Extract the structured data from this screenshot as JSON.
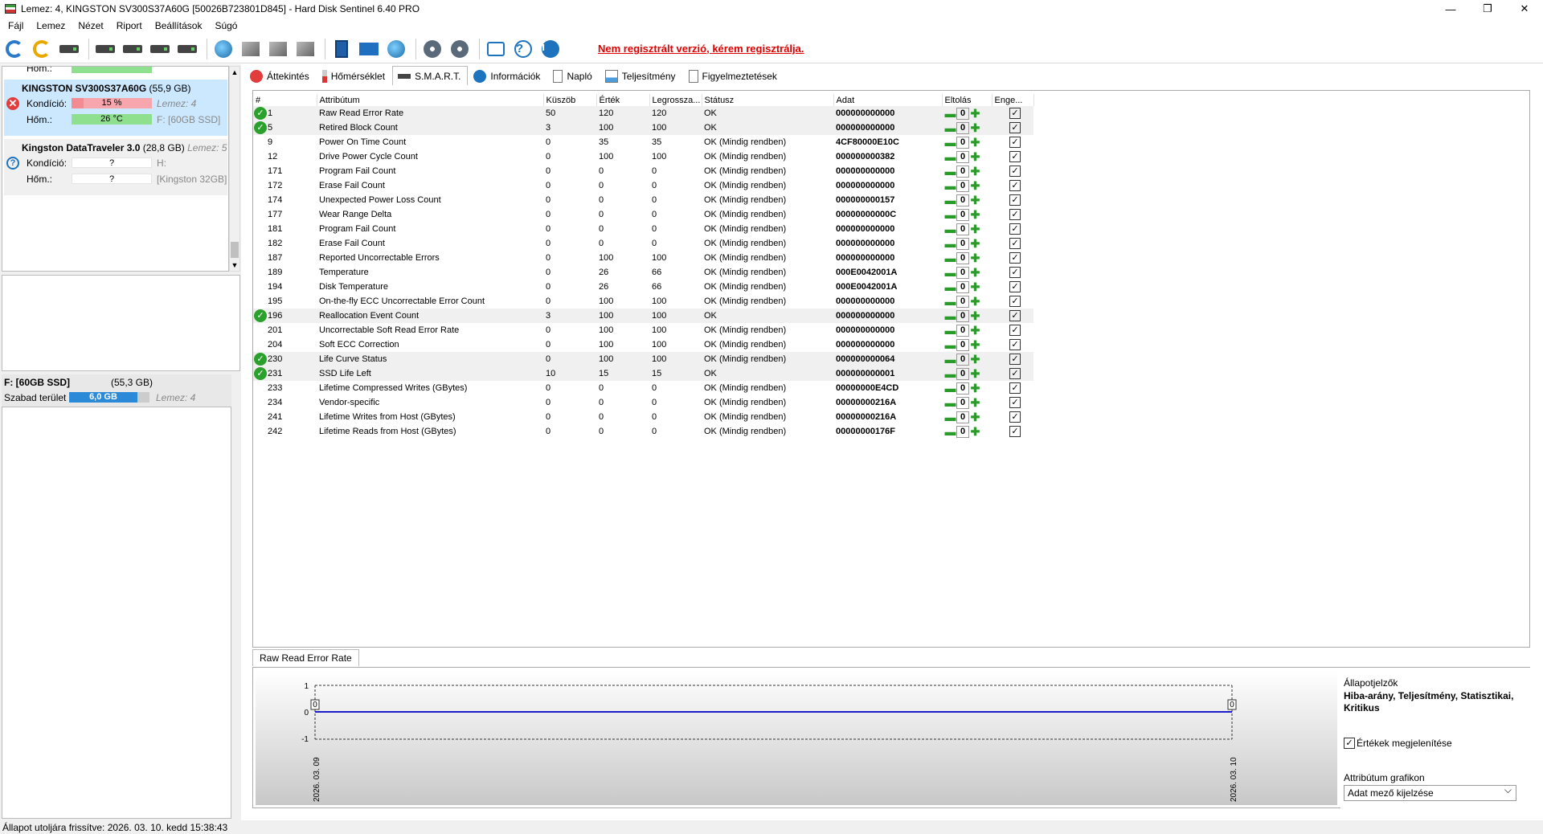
{
  "window": {
    "title": "Lemez: 4, KINGSTON SV300S37A60G [50026B723801D845]  -  Hard Disk Sentinel 6.40 PRO"
  },
  "menu": [
    "Fájl",
    "Lemez",
    "Nézet",
    "Riport",
    "Beállítások",
    "Súgó"
  ],
  "toolbar": {
    "register_text": "Nem regisztrált verzió, kérem regisztrálja."
  },
  "left": {
    "partial_row": "Hőm.:",
    "disk1": {
      "name": "KINGSTON SV300S37A60G",
      "size": "(55,9 GB)",
      "health_label": "Kondíció:",
      "health": "15 %",
      "health_extra": "Lemez: 4",
      "temp_label": "Hőm.:",
      "temp": "26 °C",
      "temp_extra": "F: [60GB SSD]"
    },
    "disk2": {
      "name": "Kingston DataTraveler 3.0",
      "size": "(28,8 GB)",
      "disk_no": "Lemez: 5",
      "health_label": "Kondíció:",
      "health": "?",
      "health_extra": "H:",
      "temp_label": "Hőm.:",
      "temp": "?",
      "temp_extra": "[Kingston 32GB]"
    },
    "volume": {
      "title": "F: [60GB SSD]",
      "size": "(55,3 GB)",
      "free_label": "Szabad terület",
      "free": "6,0 GB",
      "disk_no": "Lemez: 4"
    }
  },
  "tabs": [
    "Áttekintés",
    "Hőmérséklet",
    "S.M.A.R.T.",
    "Információk",
    "Napló",
    "Teljesítmény",
    "Figyelmeztetések"
  ],
  "smart": {
    "columns": [
      "#",
      "Attribútum",
      "Küszöb",
      "Érték",
      "Legrossza...",
      "Státusz",
      "Adat",
      "Eltolás",
      "Enge..."
    ],
    "rows": [
      {
        "id": "1",
        "name": "Raw Read Error Rate",
        "thr": "50",
        "val": "120",
        "worst": "120",
        "status": "OK",
        "data": "000000000000",
        "flag": true
      },
      {
        "id": "5",
        "name": "Retired Block Count",
        "thr": "3",
        "val": "100",
        "worst": "100",
        "status": "OK",
        "data": "000000000000",
        "flag": true
      },
      {
        "id": "9",
        "name": "Power On Time Count",
        "thr": "0",
        "val": "35",
        "worst": "35",
        "status": "OK (Mindig rendben)",
        "data": "4CF80000E10C",
        "flag": false
      },
      {
        "id": "12",
        "name": "Drive Power Cycle Count",
        "thr": "0",
        "val": "100",
        "worst": "100",
        "status": "OK (Mindig rendben)",
        "data": "000000000382",
        "flag": false
      },
      {
        "id": "171",
        "name": "Program Fail Count",
        "thr": "0",
        "val": "0",
        "worst": "0",
        "status": "OK (Mindig rendben)",
        "data": "000000000000",
        "flag": false
      },
      {
        "id": "172",
        "name": "Erase Fail Count",
        "thr": "0",
        "val": "0",
        "worst": "0",
        "status": "OK (Mindig rendben)",
        "data": "000000000000",
        "flag": false
      },
      {
        "id": "174",
        "name": "Unexpected Power Loss Count",
        "thr": "0",
        "val": "0",
        "worst": "0",
        "status": "OK (Mindig rendben)",
        "data": "000000000157",
        "flag": false
      },
      {
        "id": "177",
        "name": "Wear Range Delta",
        "thr": "0",
        "val": "0",
        "worst": "0",
        "status": "OK (Mindig rendben)",
        "data": "00000000000C",
        "flag": false
      },
      {
        "id": "181",
        "name": "Program Fail Count",
        "thr": "0",
        "val": "0",
        "worst": "0",
        "status": "OK (Mindig rendben)",
        "data": "000000000000",
        "flag": false
      },
      {
        "id": "182",
        "name": "Erase Fail Count",
        "thr": "0",
        "val": "0",
        "worst": "0",
        "status": "OK (Mindig rendben)",
        "data": "000000000000",
        "flag": false
      },
      {
        "id": "187",
        "name": "Reported Uncorrectable Errors",
        "thr": "0",
        "val": "100",
        "worst": "100",
        "status": "OK (Mindig rendben)",
        "data": "000000000000",
        "flag": false
      },
      {
        "id": "189",
        "name": "Temperature",
        "thr": "0",
        "val": "26",
        "worst": "66",
        "status": "OK (Mindig rendben)",
        "data": "000E0042001A",
        "flag": false
      },
      {
        "id": "194",
        "name": "Disk Temperature",
        "thr": "0",
        "val": "26",
        "worst": "66",
        "status": "OK (Mindig rendben)",
        "data": "000E0042001A",
        "flag": false
      },
      {
        "id": "195",
        "name": "On-the-fly ECC Uncorrectable Error Count",
        "thr": "0",
        "val": "100",
        "worst": "100",
        "status": "OK (Mindig rendben)",
        "data": "000000000000",
        "flag": false
      },
      {
        "id": "196",
        "name": "Reallocation Event Count",
        "thr": "3",
        "val": "100",
        "worst": "100",
        "status": "OK",
        "data": "000000000000",
        "flag": true
      },
      {
        "id": "201",
        "name": "Uncorrectable Soft Read Error Rate",
        "thr": "0",
        "val": "100",
        "worst": "100",
        "status": "OK (Mindig rendben)",
        "data": "000000000000",
        "flag": false
      },
      {
        "id": "204",
        "name": "Soft ECC Correction",
        "thr": "0",
        "val": "100",
        "worst": "100",
        "status": "OK (Mindig rendben)",
        "data": "000000000000",
        "flag": false
      },
      {
        "id": "230",
        "name": "Life Curve Status",
        "thr": "0",
        "val": "100",
        "worst": "100",
        "status": "OK (Mindig rendben)",
        "data": "000000000064",
        "flag": true
      },
      {
        "id": "231",
        "name": "SSD Life Left",
        "thr": "10",
        "val": "15",
        "worst": "15",
        "status": "OK",
        "data": "000000000001",
        "flag": true
      },
      {
        "id": "233",
        "name": "Lifetime Compressed Writes (GBytes)",
        "thr": "0",
        "val": "0",
        "worst": "0",
        "status": "OK (Mindig rendben)",
        "data": "00000000E4CD",
        "flag": false
      },
      {
        "id": "234",
        "name": "Vendor-specific",
        "thr": "0",
        "val": "0",
        "worst": "0",
        "status": "OK (Mindig rendben)",
        "data": "00000000216A",
        "flag": false
      },
      {
        "id": "241",
        "name": "Lifetime Writes from Host (GBytes)",
        "thr": "0",
        "val": "0",
        "worst": "0",
        "status": "OK (Mindig rendben)",
        "data": "00000000216A",
        "flag": false
      },
      {
        "id": "242",
        "name": "Lifetime Reads from Host (GBytes)",
        "thr": "0",
        "val": "0",
        "worst": "0",
        "status": "OK (Mindig rendben)",
        "data": "00000000176F",
        "flag": false
      }
    ],
    "offset_value": "0"
  },
  "graph": {
    "tab": "Raw Read Error Rate",
    "y_ticks": [
      "1",
      "0",
      "-1"
    ],
    "point_labels": [
      "0",
      "0"
    ],
    "x_labels": [
      "2026. 03. 09",
      "2026. 03. 10"
    ],
    "legend_title": "Állapotjelzők",
    "legend_text": "Hiba-arány, Teljesítmény, Statisztikai, Kritikus",
    "show_values_label": "Értékek megjelenítése",
    "attr_graph_label": "Attribútum grafikon",
    "attr_graph_value": "Adat mező kijelzése"
  },
  "status_bar": "Állapot utoljára frissítve: 2026. 03. 10. kedd 15:38:43"
}
